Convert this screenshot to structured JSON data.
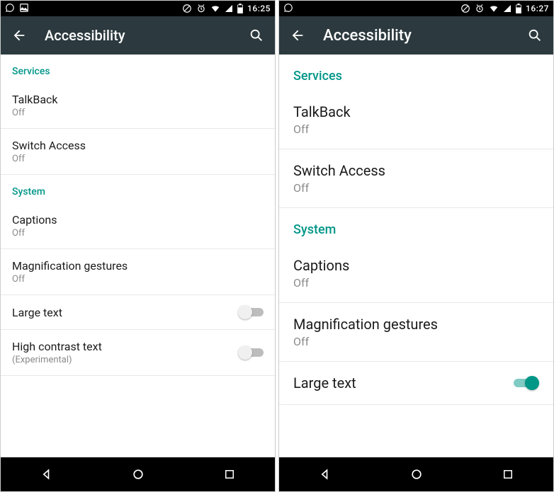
{
  "screens": [
    {
      "statusbar": {
        "time": "16:25"
      },
      "appbar": {
        "title": "Accessibility"
      },
      "sections": [
        {
          "header": "Services",
          "items": [
            {
              "title": "TalkBack",
              "sub": "Off"
            },
            {
              "title": "Switch Access",
              "sub": "Off"
            }
          ]
        },
        {
          "header": "System",
          "items": [
            {
              "title": "Captions",
              "sub": "Off"
            },
            {
              "title": "Magnification gestures",
              "sub": "Off"
            },
            {
              "title": "Large text",
              "toggle": false
            },
            {
              "title": "High contrast text",
              "sub": "(Experimental)",
              "toggle": false
            }
          ]
        }
      ]
    },
    {
      "large": true,
      "statusbar": {
        "time": "16:27"
      },
      "appbar": {
        "title": "Accessibility"
      },
      "sections": [
        {
          "header": "Services",
          "items": [
            {
              "title": "TalkBack",
              "sub": "Off"
            },
            {
              "title": "Switch Access",
              "sub": "Off"
            }
          ]
        },
        {
          "header": "System",
          "items": [
            {
              "title": "Captions",
              "sub": "Off"
            },
            {
              "title": "Magnification gestures",
              "sub": "Off"
            },
            {
              "title": "Large text",
              "toggle": true
            }
          ]
        }
      ],
      "peek": ""
    }
  ],
  "icons": {
    "back": "back-arrow-icon",
    "search": "search-icon",
    "nav_back": "nav-back-icon",
    "nav_home": "nav-home-icon",
    "nav_recent": "nav-recent-icon"
  }
}
